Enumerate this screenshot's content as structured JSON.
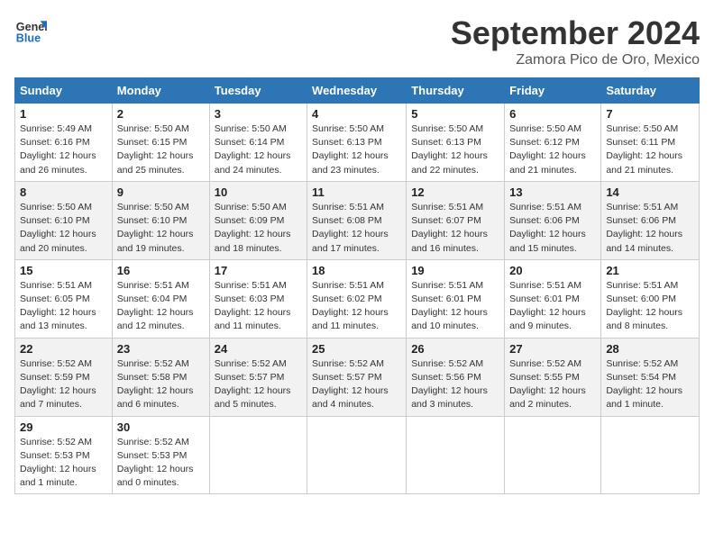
{
  "logo": {
    "line1": "General",
    "line2": "Blue"
  },
  "title": "September 2024",
  "subtitle": "Zamora Pico de Oro, Mexico",
  "days_header": [
    "Sunday",
    "Monday",
    "Tuesday",
    "Wednesday",
    "Thursday",
    "Friday",
    "Saturday"
  ],
  "weeks": [
    [
      {
        "num": "1",
        "sunrise": "Sunrise: 5:49 AM",
        "sunset": "Sunset: 6:16 PM",
        "daylight": "Daylight: 12 hours and 26 minutes."
      },
      {
        "num": "2",
        "sunrise": "Sunrise: 5:50 AM",
        "sunset": "Sunset: 6:15 PM",
        "daylight": "Daylight: 12 hours and 25 minutes."
      },
      {
        "num": "3",
        "sunrise": "Sunrise: 5:50 AM",
        "sunset": "Sunset: 6:14 PM",
        "daylight": "Daylight: 12 hours and 24 minutes."
      },
      {
        "num": "4",
        "sunrise": "Sunrise: 5:50 AM",
        "sunset": "Sunset: 6:13 PM",
        "daylight": "Daylight: 12 hours and 23 minutes."
      },
      {
        "num": "5",
        "sunrise": "Sunrise: 5:50 AM",
        "sunset": "Sunset: 6:13 PM",
        "daylight": "Daylight: 12 hours and 22 minutes."
      },
      {
        "num": "6",
        "sunrise": "Sunrise: 5:50 AM",
        "sunset": "Sunset: 6:12 PM",
        "daylight": "Daylight: 12 hours and 21 minutes."
      },
      {
        "num": "7",
        "sunrise": "Sunrise: 5:50 AM",
        "sunset": "Sunset: 6:11 PM",
        "daylight": "Daylight: 12 hours and 21 minutes."
      }
    ],
    [
      {
        "num": "8",
        "sunrise": "Sunrise: 5:50 AM",
        "sunset": "Sunset: 6:10 PM",
        "daylight": "Daylight: 12 hours and 20 minutes."
      },
      {
        "num": "9",
        "sunrise": "Sunrise: 5:50 AM",
        "sunset": "Sunset: 6:10 PM",
        "daylight": "Daylight: 12 hours and 19 minutes."
      },
      {
        "num": "10",
        "sunrise": "Sunrise: 5:50 AM",
        "sunset": "Sunset: 6:09 PM",
        "daylight": "Daylight: 12 hours and 18 minutes."
      },
      {
        "num": "11",
        "sunrise": "Sunrise: 5:51 AM",
        "sunset": "Sunset: 6:08 PM",
        "daylight": "Daylight: 12 hours and 17 minutes."
      },
      {
        "num": "12",
        "sunrise": "Sunrise: 5:51 AM",
        "sunset": "Sunset: 6:07 PM",
        "daylight": "Daylight: 12 hours and 16 minutes."
      },
      {
        "num": "13",
        "sunrise": "Sunrise: 5:51 AM",
        "sunset": "Sunset: 6:06 PM",
        "daylight": "Daylight: 12 hours and 15 minutes."
      },
      {
        "num": "14",
        "sunrise": "Sunrise: 5:51 AM",
        "sunset": "Sunset: 6:06 PM",
        "daylight": "Daylight: 12 hours and 14 minutes."
      }
    ],
    [
      {
        "num": "15",
        "sunrise": "Sunrise: 5:51 AM",
        "sunset": "Sunset: 6:05 PM",
        "daylight": "Daylight: 12 hours and 13 minutes."
      },
      {
        "num": "16",
        "sunrise": "Sunrise: 5:51 AM",
        "sunset": "Sunset: 6:04 PM",
        "daylight": "Daylight: 12 hours and 12 minutes."
      },
      {
        "num": "17",
        "sunrise": "Sunrise: 5:51 AM",
        "sunset": "Sunset: 6:03 PM",
        "daylight": "Daylight: 12 hours and 11 minutes."
      },
      {
        "num": "18",
        "sunrise": "Sunrise: 5:51 AM",
        "sunset": "Sunset: 6:02 PM",
        "daylight": "Daylight: 12 hours and 11 minutes."
      },
      {
        "num": "19",
        "sunrise": "Sunrise: 5:51 AM",
        "sunset": "Sunset: 6:01 PM",
        "daylight": "Daylight: 12 hours and 10 minutes."
      },
      {
        "num": "20",
        "sunrise": "Sunrise: 5:51 AM",
        "sunset": "Sunset: 6:01 PM",
        "daylight": "Daylight: 12 hours and 9 minutes."
      },
      {
        "num": "21",
        "sunrise": "Sunrise: 5:51 AM",
        "sunset": "Sunset: 6:00 PM",
        "daylight": "Daylight: 12 hours and 8 minutes."
      }
    ],
    [
      {
        "num": "22",
        "sunrise": "Sunrise: 5:52 AM",
        "sunset": "Sunset: 5:59 PM",
        "daylight": "Daylight: 12 hours and 7 minutes."
      },
      {
        "num": "23",
        "sunrise": "Sunrise: 5:52 AM",
        "sunset": "Sunset: 5:58 PM",
        "daylight": "Daylight: 12 hours and 6 minutes."
      },
      {
        "num": "24",
        "sunrise": "Sunrise: 5:52 AM",
        "sunset": "Sunset: 5:57 PM",
        "daylight": "Daylight: 12 hours and 5 minutes."
      },
      {
        "num": "25",
        "sunrise": "Sunrise: 5:52 AM",
        "sunset": "Sunset: 5:57 PM",
        "daylight": "Daylight: 12 hours and 4 minutes."
      },
      {
        "num": "26",
        "sunrise": "Sunrise: 5:52 AM",
        "sunset": "Sunset: 5:56 PM",
        "daylight": "Daylight: 12 hours and 3 minutes."
      },
      {
        "num": "27",
        "sunrise": "Sunrise: 5:52 AM",
        "sunset": "Sunset: 5:55 PM",
        "daylight": "Daylight: 12 hours and 2 minutes."
      },
      {
        "num": "28",
        "sunrise": "Sunrise: 5:52 AM",
        "sunset": "Sunset: 5:54 PM",
        "daylight": "Daylight: 12 hours and 1 minute."
      }
    ],
    [
      {
        "num": "29",
        "sunrise": "Sunrise: 5:52 AM",
        "sunset": "Sunset: 5:53 PM",
        "daylight": "Daylight: 12 hours and 1 minute."
      },
      {
        "num": "30",
        "sunrise": "Sunrise: 5:52 AM",
        "sunset": "Sunset: 5:53 PM",
        "daylight": "Daylight: 12 hours and 0 minutes."
      },
      null,
      null,
      null,
      null,
      null
    ]
  ]
}
